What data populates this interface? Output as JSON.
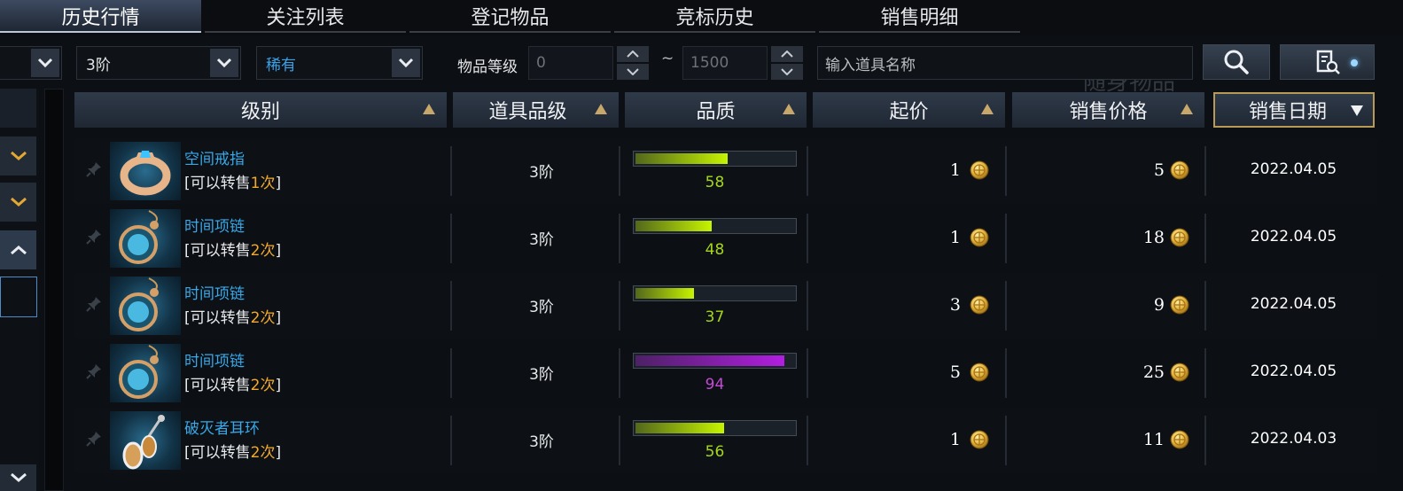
{
  "tabs": [
    "历史行情",
    "关注列表",
    "登记物品",
    "竞标历史",
    "销售明细"
  ],
  "filters": {
    "tier_value": "3阶",
    "rarity_value": "稀有",
    "level_label": "物品等级",
    "level_min": "0",
    "level_tilde": "~",
    "level_max": "1500",
    "search_placeholder": "输入道具名称"
  },
  "background_text": "随身物品",
  "columns": [
    "级别",
    "道具品级",
    "品质",
    "起价",
    "销售价格",
    "销售日期"
  ],
  "colors": {
    "green_bar": "#c6f400",
    "purple_bar": "#b21ee0",
    "green_text": "#a6d61a",
    "purple_text": "#c44ad6"
  },
  "rows": [
    {
      "name": "空间戒指",
      "trade_prefix": "[可以转售",
      "trade_count": "1次",
      "trade_suffix": "]",
      "tier": "3阶",
      "quality": "58",
      "quality_color": "green",
      "start_price": "1",
      "sale_price": "5",
      "date": "2022.04.05",
      "icon": "ring-icon"
    },
    {
      "name": "时间项链",
      "trade_prefix": "[可以转售",
      "trade_count": "2次",
      "trade_suffix": "]",
      "tier": "3阶",
      "quality": "48",
      "quality_color": "green",
      "start_price": "1",
      "sale_price": "18",
      "date": "2022.04.05",
      "icon": "necklace-icon"
    },
    {
      "name": "时间项链",
      "trade_prefix": "[可以转售",
      "trade_count": "2次",
      "trade_suffix": "]",
      "tier": "3阶",
      "quality": "37",
      "quality_color": "green",
      "start_price": "3",
      "sale_price": "9",
      "date": "2022.04.05",
      "icon": "necklace-icon"
    },
    {
      "name": "时间项链",
      "trade_prefix": "[可以转售",
      "trade_count": "2次",
      "trade_suffix": "]",
      "tier": "3阶",
      "quality": "94",
      "quality_color": "purple",
      "start_price": "5",
      "sale_price": "25",
      "date": "2022.04.05",
      "icon": "necklace-icon"
    },
    {
      "name": "破灭者耳环",
      "trade_prefix": "[可以转售",
      "trade_count": "2次",
      "trade_suffix": "]",
      "tier": "3阶",
      "quality": "56",
      "quality_color": "green",
      "start_price": "1",
      "sale_price": "11",
      "date": "2022.04.03",
      "icon": "earring-icon"
    }
  ]
}
